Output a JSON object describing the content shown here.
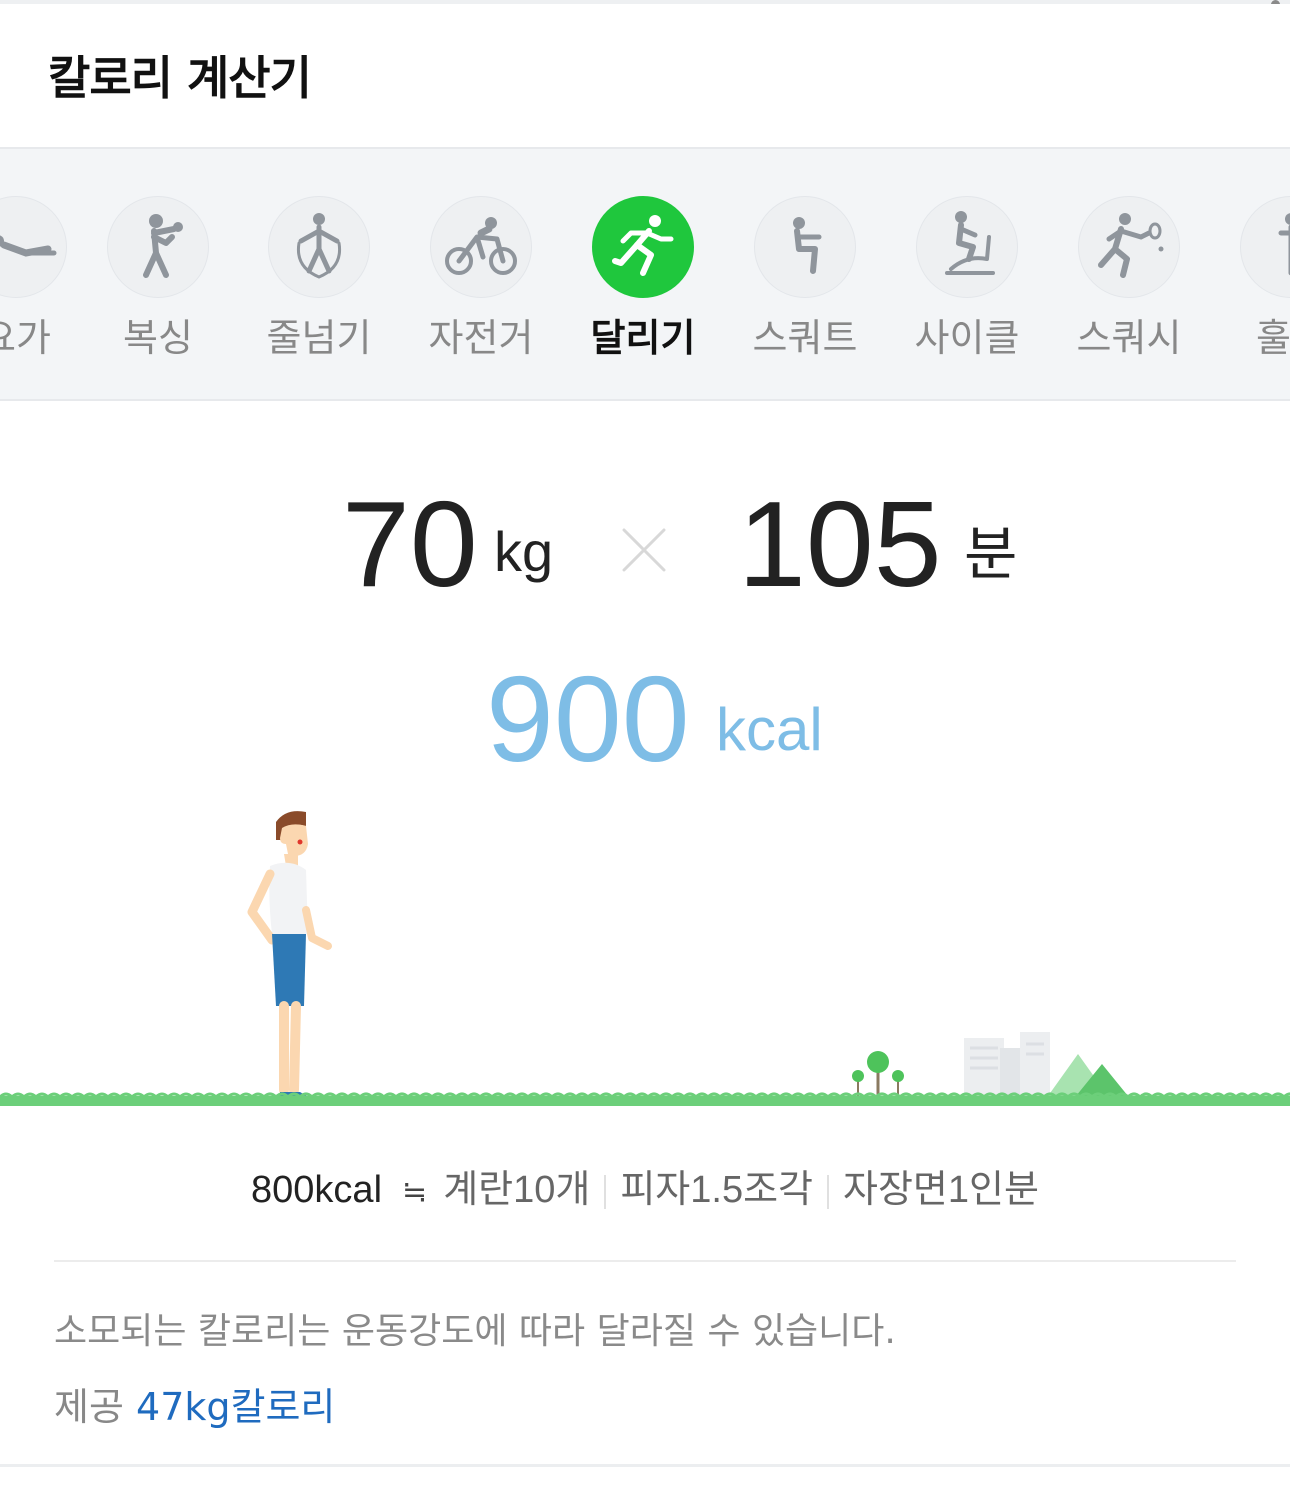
{
  "header": {
    "title": "칼로리 계산기"
  },
  "tabs": [
    {
      "label": "요가",
      "icon": "yoga-icon"
    },
    {
      "label": "복싱",
      "icon": "boxing-icon"
    },
    {
      "label": "줄넘기",
      "icon": "jump-rope-icon"
    },
    {
      "label": "자전거",
      "icon": "bicycle-icon"
    },
    {
      "label": "달리기",
      "icon": "running-icon",
      "active": true
    },
    {
      "label": "스쿼트",
      "icon": "squat-icon"
    },
    {
      "label": "사이클",
      "icon": "stationary-cycle-icon"
    },
    {
      "label": "스쿼시",
      "icon": "squash-icon"
    },
    {
      "label": "훌라",
      "icon": "hula-hoop-icon"
    }
  ],
  "calc": {
    "weight_value": "70",
    "weight_unit": "kg",
    "minutes_value": "105",
    "minutes_unit": "분",
    "kcal_value": "900",
    "kcal_unit": "kcal"
  },
  "equivalents": {
    "main": "800kcal",
    "approx": "≒",
    "items": [
      "계란10개",
      "피자1.5조각",
      "자장면1인분"
    ]
  },
  "note": "소모되는 칼로리는 운동강도에 따라 달라질 수 있습니다.",
  "credit": {
    "prefix": "제공",
    "link": "47kg칼로리"
  },
  "colors": {
    "active": "#1fc73d",
    "kcal": "#7ebde6",
    "link": "#1f6bbf",
    "grass": "#6ccf7a"
  }
}
